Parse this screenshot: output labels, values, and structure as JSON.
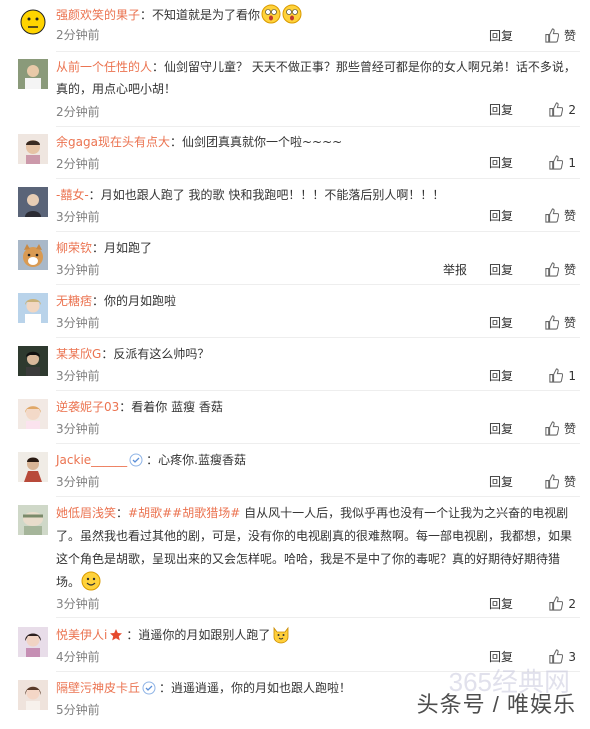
{
  "actions": {
    "reply": "回复",
    "like": "赞",
    "report": "举报"
  },
  "comments": [
    {
      "user": "强颜欢笑的果子",
      "text": "不知道就是为了看你",
      "time": "2分钟前",
      "likes": ""
    },
    {
      "user": "从前一个任性的人",
      "text": "仙剑留守儿童？ 天天不做正事？那些曾经可都是你的女人啊兄弟！话不多说，真的，用点心吧小胡！",
      "time": "2分钟前",
      "likes": "2"
    },
    {
      "user": "余gaga现在头有点大",
      "text": "仙剑团真真就你一个啦~~~~",
      "time": "2分钟前",
      "likes": "1"
    },
    {
      "user": "-囍女-",
      "text": "月如也跟人跑了 我的歌 快和我跑吧！！！不能落后别人啊！！！",
      "time": "3分钟前",
      "likes": ""
    },
    {
      "user": "柳荣钦",
      "text": "月如跑了",
      "time": "3分钟前",
      "likes": ""
    },
    {
      "user": "无糖痞",
      "text": "你的月如跑啦",
      "time": "3分钟前",
      "likes": ""
    },
    {
      "user": "某某欣G",
      "text": "反派有这么帅吗？",
      "time": "3分钟前",
      "likes": "1"
    },
    {
      "user": "逆袭妮子03",
      "text": "看着你 蓝瘦 香菇",
      "time": "3分钟前",
      "likes": ""
    },
    {
      "user": "Jackie______",
      "text": "心疼你.蓝瘦香菇",
      "time": "3分钟前",
      "likes": ""
    },
    {
      "user": "她低眉浅笑",
      "tag1": "#胡歌#",
      "tag2": "#胡歌猎场#",
      "text": "自从风十一人后，我似乎再也没有一个让我为之兴奋的电视剧了。虽然我也看过其他的剧，可是，没有你的电视剧真的很难熬啊。每一部电视剧，我都想，如果这个角色是胡歌，呈现出来的又会怎样呢。哈哈，我是不是中了你的毒呢？真的好期待好期待猎场。",
      "time": "3分钟前",
      "likes": "2"
    },
    {
      "user": "悦美伊人i",
      "text": "逍遥你的月如跟别人跑了",
      "time": "4分钟前",
      "likes": "3"
    },
    {
      "user": "隔壁污神皮卡丘",
      "text": "逍遥逍遥，你的月如也跟人跑啦！",
      "time": "5分钟前",
      "likes": ""
    }
  ],
  "watermark": {
    "line1": "365经典网",
    "line2": "头条号 / 唯娱乐"
  }
}
